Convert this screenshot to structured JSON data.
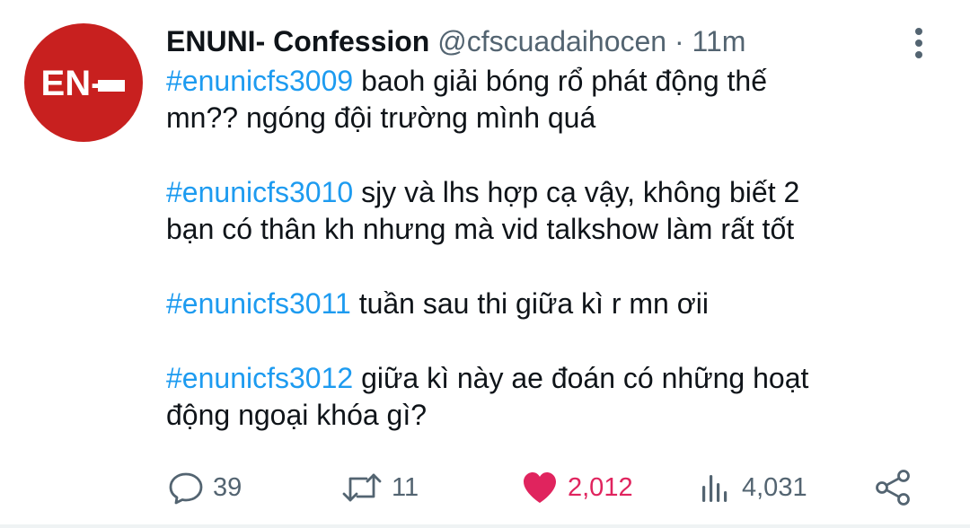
{
  "tweet": {
    "avatar_text": "EN-",
    "author": {
      "display_name": "ENUNI- Confession",
      "handle": "@cfscuadaihocen",
      "separator": "·",
      "time": "11m"
    },
    "paragraphs": [
      {
        "lines": [
          {
            "hashtag": "#enunicfs3009",
            "text": " baoh giải bóng rổ phát động thế"
          },
          {
            "text": "mn?? ngóng đội trường mình quá"
          }
        ]
      },
      {
        "lines": [
          {
            "hashtag": "#enunicfs3010",
            "text": " sjy và lhs hợp cạ vậy, không biết 2"
          },
          {
            "text": "bạn có thân kh nhưng mà vid talkshow làm rất tốt"
          }
        ]
      },
      {
        "lines": [
          {
            "hashtag": "#enunicfs3011",
            "text": " tuần sau thi giữa kì r mn ơii"
          }
        ]
      },
      {
        "lines": [
          {
            "hashtag": "#enunicfs3012",
            "text": " giữa kì này ae đoán có những hoạt"
          },
          {
            "text": "động ngoại khóa gì?"
          }
        ]
      }
    ],
    "actions": {
      "replies": "39",
      "retweets": "11",
      "likes": "2,012",
      "views": "4,031"
    },
    "colors": {
      "hashtag": "#1d9bf0",
      "like": "#e0245e",
      "muted": "#536471",
      "avatar_bg": "#c8201f"
    }
  }
}
